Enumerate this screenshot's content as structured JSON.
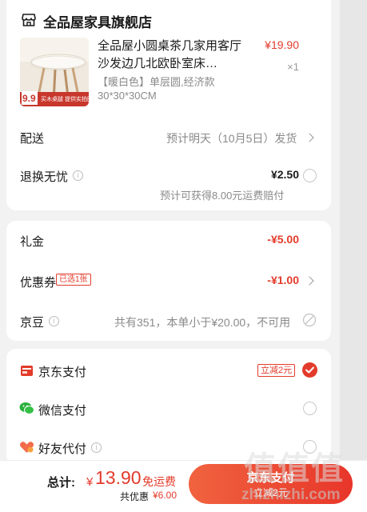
{
  "shop": {
    "name": "全品屋家具旗舰店",
    "icon": "store-icon"
  },
  "product": {
    "title": "全品屋小圆桌茶几家用客厅沙发边几北欧卧室床…",
    "price": "¥19.90",
    "quantity": "×1",
    "spec_line1": "【暖白色】单层圆,经济款",
    "spec_line2": "30*30*30CM",
    "thumb_badge": "9.9",
    "thumb_caption": "买木桌腿 提供实拍图"
  },
  "delivery": {
    "label": "配送",
    "value": "预计明天（10月5日）发货"
  },
  "return_insurance": {
    "label": "退换无忧",
    "price": "¥2.50",
    "note": "预计可获得8.00元运费赔付"
  },
  "gift_card": {
    "label": "礼金",
    "value": "-¥5.00"
  },
  "coupon": {
    "label": "优惠券",
    "tag": "已选1张",
    "value": "-¥1.00"
  },
  "jingdou": {
    "label": "京豆",
    "note": "共有351，本单小于¥20.00，不可用"
  },
  "payment_methods": [
    {
      "label": "京东支付",
      "tag": "立减2元",
      "selected": true,
      "icon": "jd-pay-icon"
    },
    {
      "label": "微信支付",
      "selected": false,
      "icon": "wechat-pay-icon"
    },
    {
      "label": "好友代付",
      "selected": false,
      "icon": "friend-pay-icon"
    }
  ],
  "footer": {
    "total_label": "总计:",
    "currency": "¥",
    "total_amount": "13.90",
    "free_shipping": "免运费",
    "saved_label": "共优惠",
    "saved_amount": "¥6.00",
    "pay_button": "京东支付",
    "pay_button_sub": "立减2元"
  },
  "watermark": {
    "text": "值值值",
    "domain": "zhizhizhi.com"
  },
  "colors": {
    "accent": "#e33b2b",
    "wechat": "#2aae3b"
  }
}
